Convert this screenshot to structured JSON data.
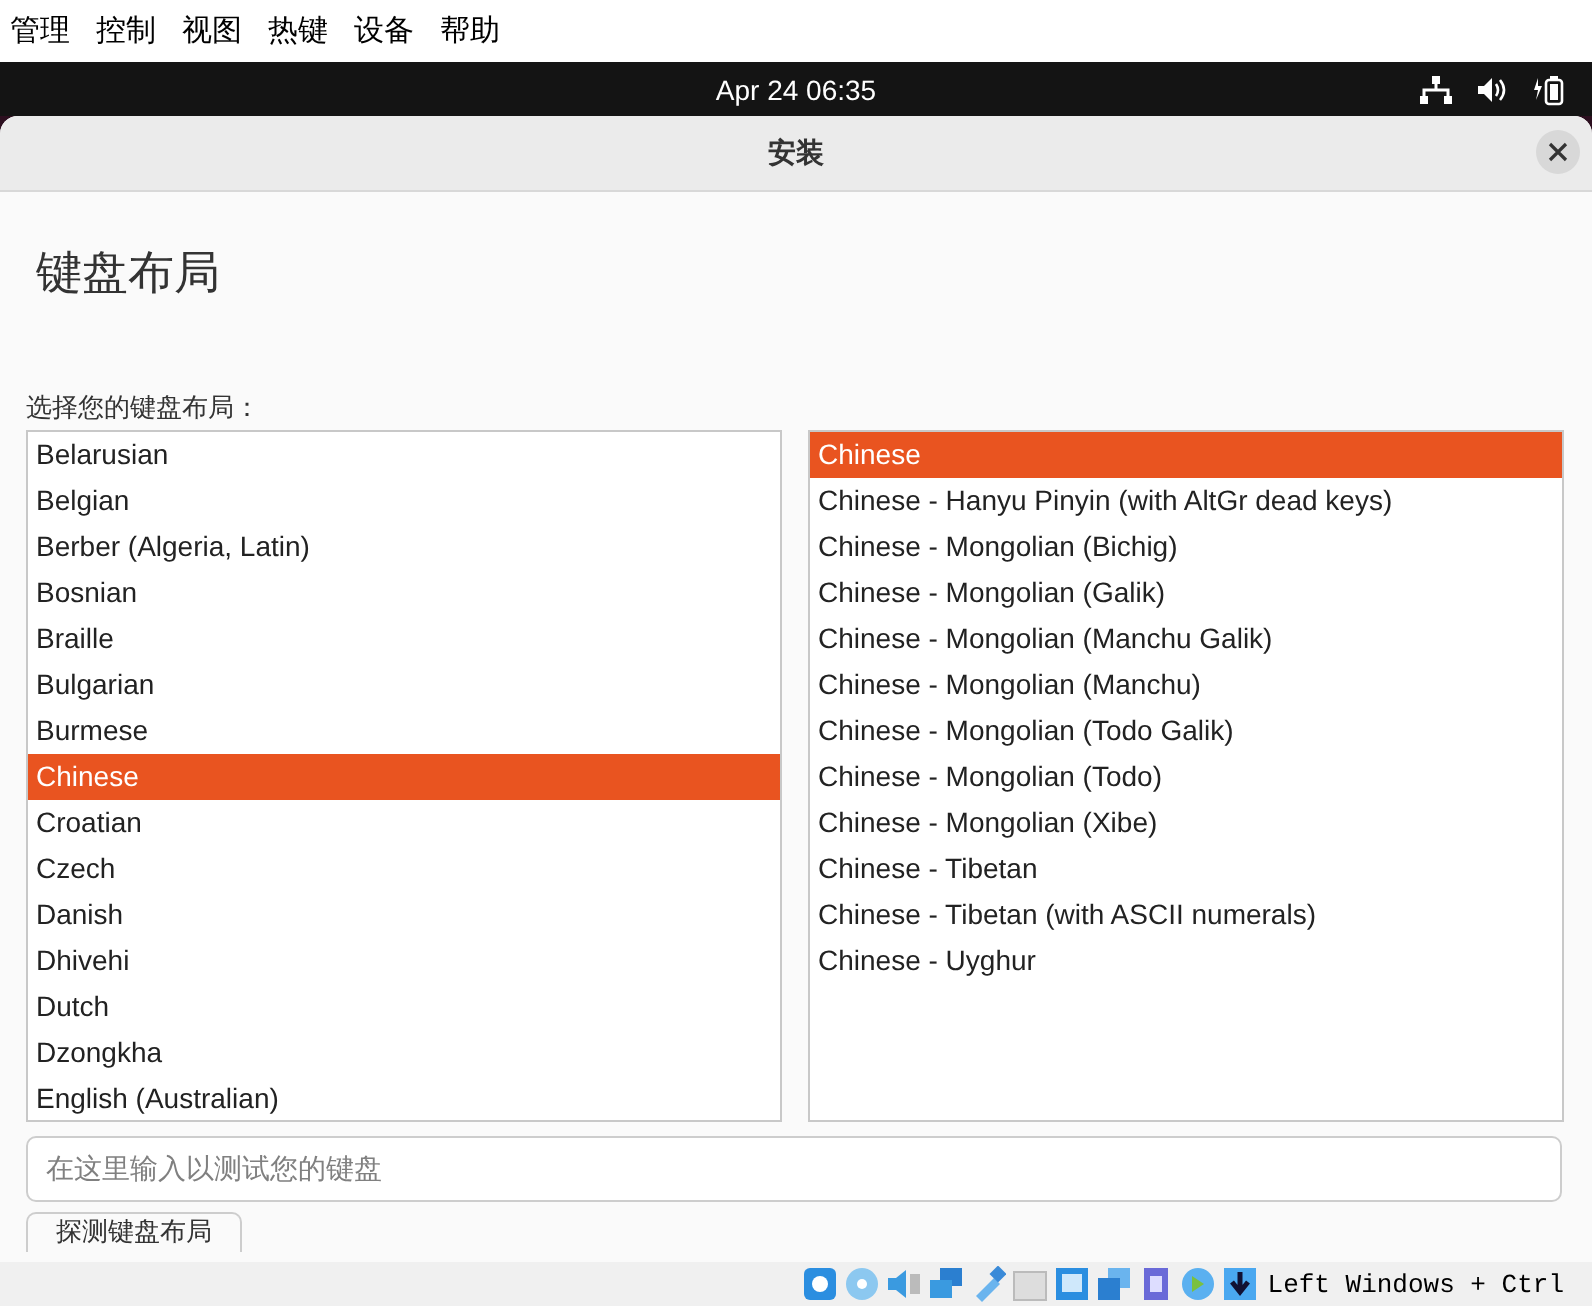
{
  "menu_bar": [
    "管理",
    "控制",
    "视图",
    "热键",
    "设备",
    "帮助"
  ],
  "top_panel": {
    "clock": "Apr 24  06:35"
  },
  "dialog": {
    "title": "安装",
    "heading": "键盘布局",
    "prompt": "选择您的键盘布局：",
    "layouts": [
      {
        "label": "Belarusian",
        "selected": false
      },
      {
        "label": "Belgian",
        "selected": false
      },
      {
        "label": "Berber (Algeria, Latin)",
        "selected": false
      },
      {
        "label": "Bosnian",
        "selected": false
      },
      {
        "label": "Braille",
        "selected": false
      },
      {
        "label": "Bulgarian",
        "selected": false
      },
      {
        "label": "Burmese",
        "selected": false
      },
      {
        "label": "Chinese",
        "selected": true
      },
      {
        "label": "Croatian",
        "selected": false
      },
      {
        "label": "Czech",
        "selected": false
      },
      {
        "label": "Danish",
        "selected": false
      },
      {
        "label": "Dhivehi",
        "selected": false
      },
      {
        "label": "Dutch",
        "selected": false
      },
      {
        "label": "Dzongkha",
        "selected": false
      },
      {
        "label": "English (Australian)",
        "selected": false
      }
    ],
    "variants": [
      {
        "label": "Chinese",
        "selected": true
      },
      {
        "label": "Chinese - Hanyu Pinyin (with AltGr dead keys)",
        "selected": false
      },
      {
        "label": "Chinese - Mongolian (Bichig)",
        "selected": false
      },
      {
        "label": "Chinese - Mongolian (Galik)",
        "selected": false
      },
      {
        "label": "Chinese - Mongolian (Manchu Galik)",
        "selected": false
      },
      {
        "label": "Chinese - Mongolian (Manchu)",
        "selected": false
      },
      {
        "label": "Chinese - Mongolian (Todo Galik)",
        "selected": false
      },
      {
        "label": "Chinese - Mongolian (Todo)",
        "selected": false
      },
      {
        "label": "Chinese - Mongolian (Xibe)",
        "selected": false
      },
      {
        "label": "Chinese - Tibetan",
        "selected": false
      },
      {
        "label": "Chinese - Tibetan (with ASCII numerals)",
        "selected": false
      },
      {
        "label": "Chinese - Uyghur",
        "selected": false
      }
    ],
    "test_field": {
      "placeholder": "在这里输入以测试您的键盘"
    },
    "detect_button": "探测键盘布局"
  },
  "status_bar": {
    "host_key": "Left Windows + Ctrl"
  }
}
